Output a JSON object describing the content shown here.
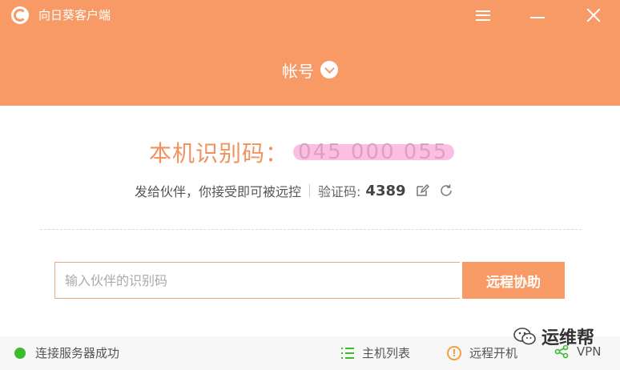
{
  "app": {
    "title": "向日葵客户端"
  },
  "header": {
    "account_label": "帐号"
  },
  "main": {
    "id_label": "本机识别码：",
    "id_value": "045 000 055",
    "forward_text": "发给伙伴，你接受即可被远控",
    "code_label": "验证码:",
    "code_value": "4389"
  },
  "connect": {
    "placeholder": "输入伙伴的识别码",
    "button_label": "远程协助"
  },
  "footer": {
    "status_text": "连接服务器成功",
    "hosts_label": "主机列表",
    "boot_label": "远程开机",
    "vpn_label": "VPN"
  },
  "watermark": {
    "text": "运维帮"
  },
  "colors": {
    "accent": "#f89a66",
    "status_ok": "#3dbb2f",
    "warning": "#f0a040"
  }
}
